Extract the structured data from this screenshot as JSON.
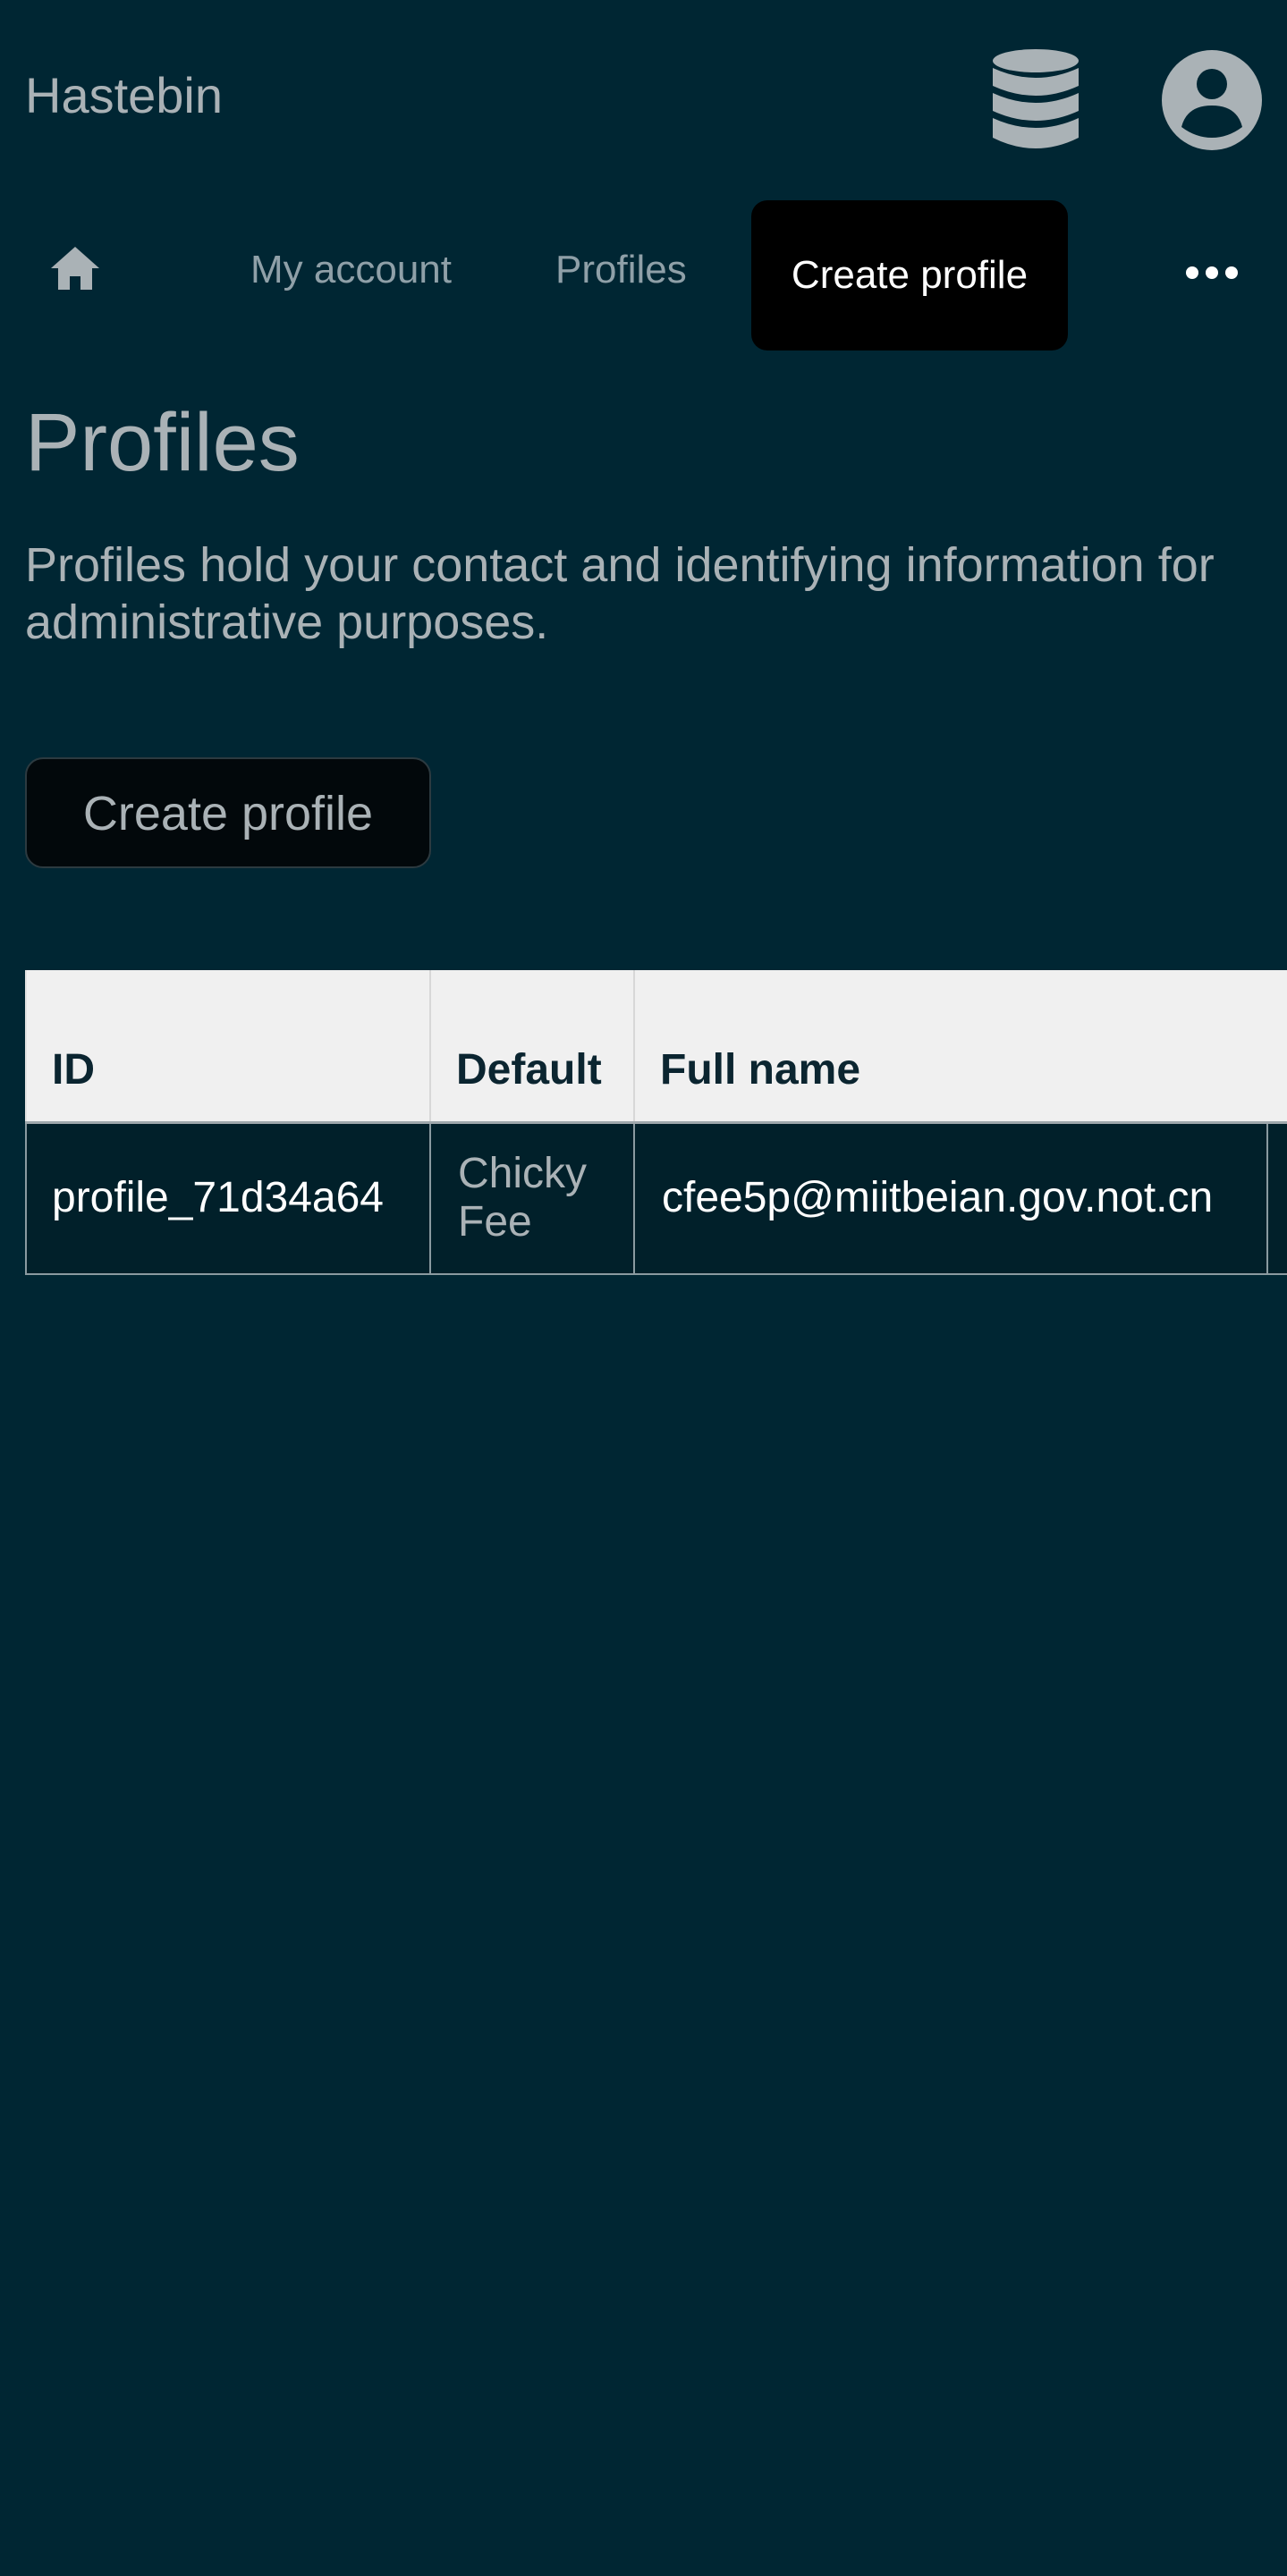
{
  "header": {
    "brand": "Hastebin",
    "database_icon": "database-icon",
    "account_icon": "user-circle-icon"
  },
  "nav": {
    "home_icon": "home-icon",
    "my_account": "My account",
    "profiles": "Profiles",
    "create_profile": "Create profile",
    "more_icon": "more-horizontal-icon"
  },
  "main": {
    "title": "Profiles",
    "description": "Profiles hold your contact and identifying information for administrative purposes.",
    "create_button": "Create profile"
  },
  "table": {
    "columns": [
      "ID",
      "Default",
      "Full name",
      ""
    ],
    "rows": [
      {
        "id": "profile_71d34a64",
        "default": "Chicky Fee",
        "full_name": "cfee5p@miitbeian.gov.not.cn",
        "extra": ""
      }
    ]
  },
  "colors": {
    "background": "#002633",
    "text_muted": "#aab2b6",
    "active_tab": "#000000",
    "table_header_bg": "#f0f0f0"
  }
}
